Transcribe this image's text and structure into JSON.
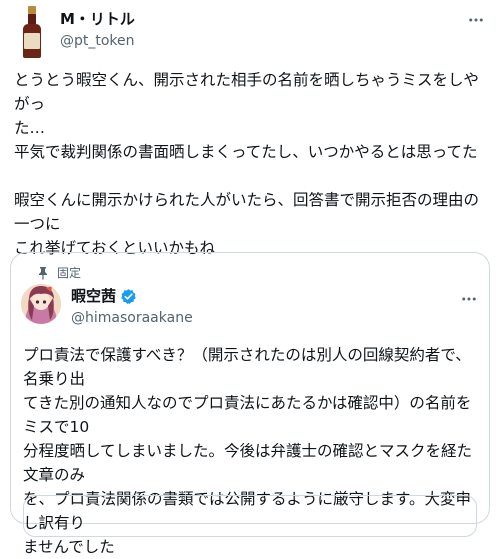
{
  "tweet": {
    "author": {
      "name": "M・リトル",
      "handle": "@pt_token"
    },
    "text_lines": [
      "とうとう暇空くん、開示された相手の名前を晒しちゃうミスをしやがっ",
      "た…",
      "平気で裁判関係の書面晒しまくってたし、いつかやるとは思ってた",
      "",
      "暇空くんに開示かけられた人がいたら、回答書で開示拒否の理由の一つに",
      "これ挙げておくといいかもね"
    ]
  },
  "quote": {
    "pinned_label": "固定",
    "author": {
      "name": "暇空茜",
      "handle": "@himasoraakane",
      "verified": true
    },
    "text_lines": [
      "プロ責法で保護すべき？（開示されたのは別人の回線契約者で、名乗り出",
      "てきた別の通知人なのでプロ責法にあたるかは確認中）の名前をミスで10",
      "分程度晒してしまいました。今後は弁護士の確認とマスクを経た文章のみ",
      "を、プロ責法関係の書類では公開するように厳守します。大変申し訳有り",
      "ませんでした"
    ]
  },
  "icons": {
    "more": "more-horizontal-icon",
    "pin": "pin-icon",
    "verified": "verified-badge-icon"
  },
  "colors": {
    "text": "#0f1419",
    "secondary": "#536471",
    "border": "#cfd9de",
    "verified": "#1d9bf0"
  }
}
